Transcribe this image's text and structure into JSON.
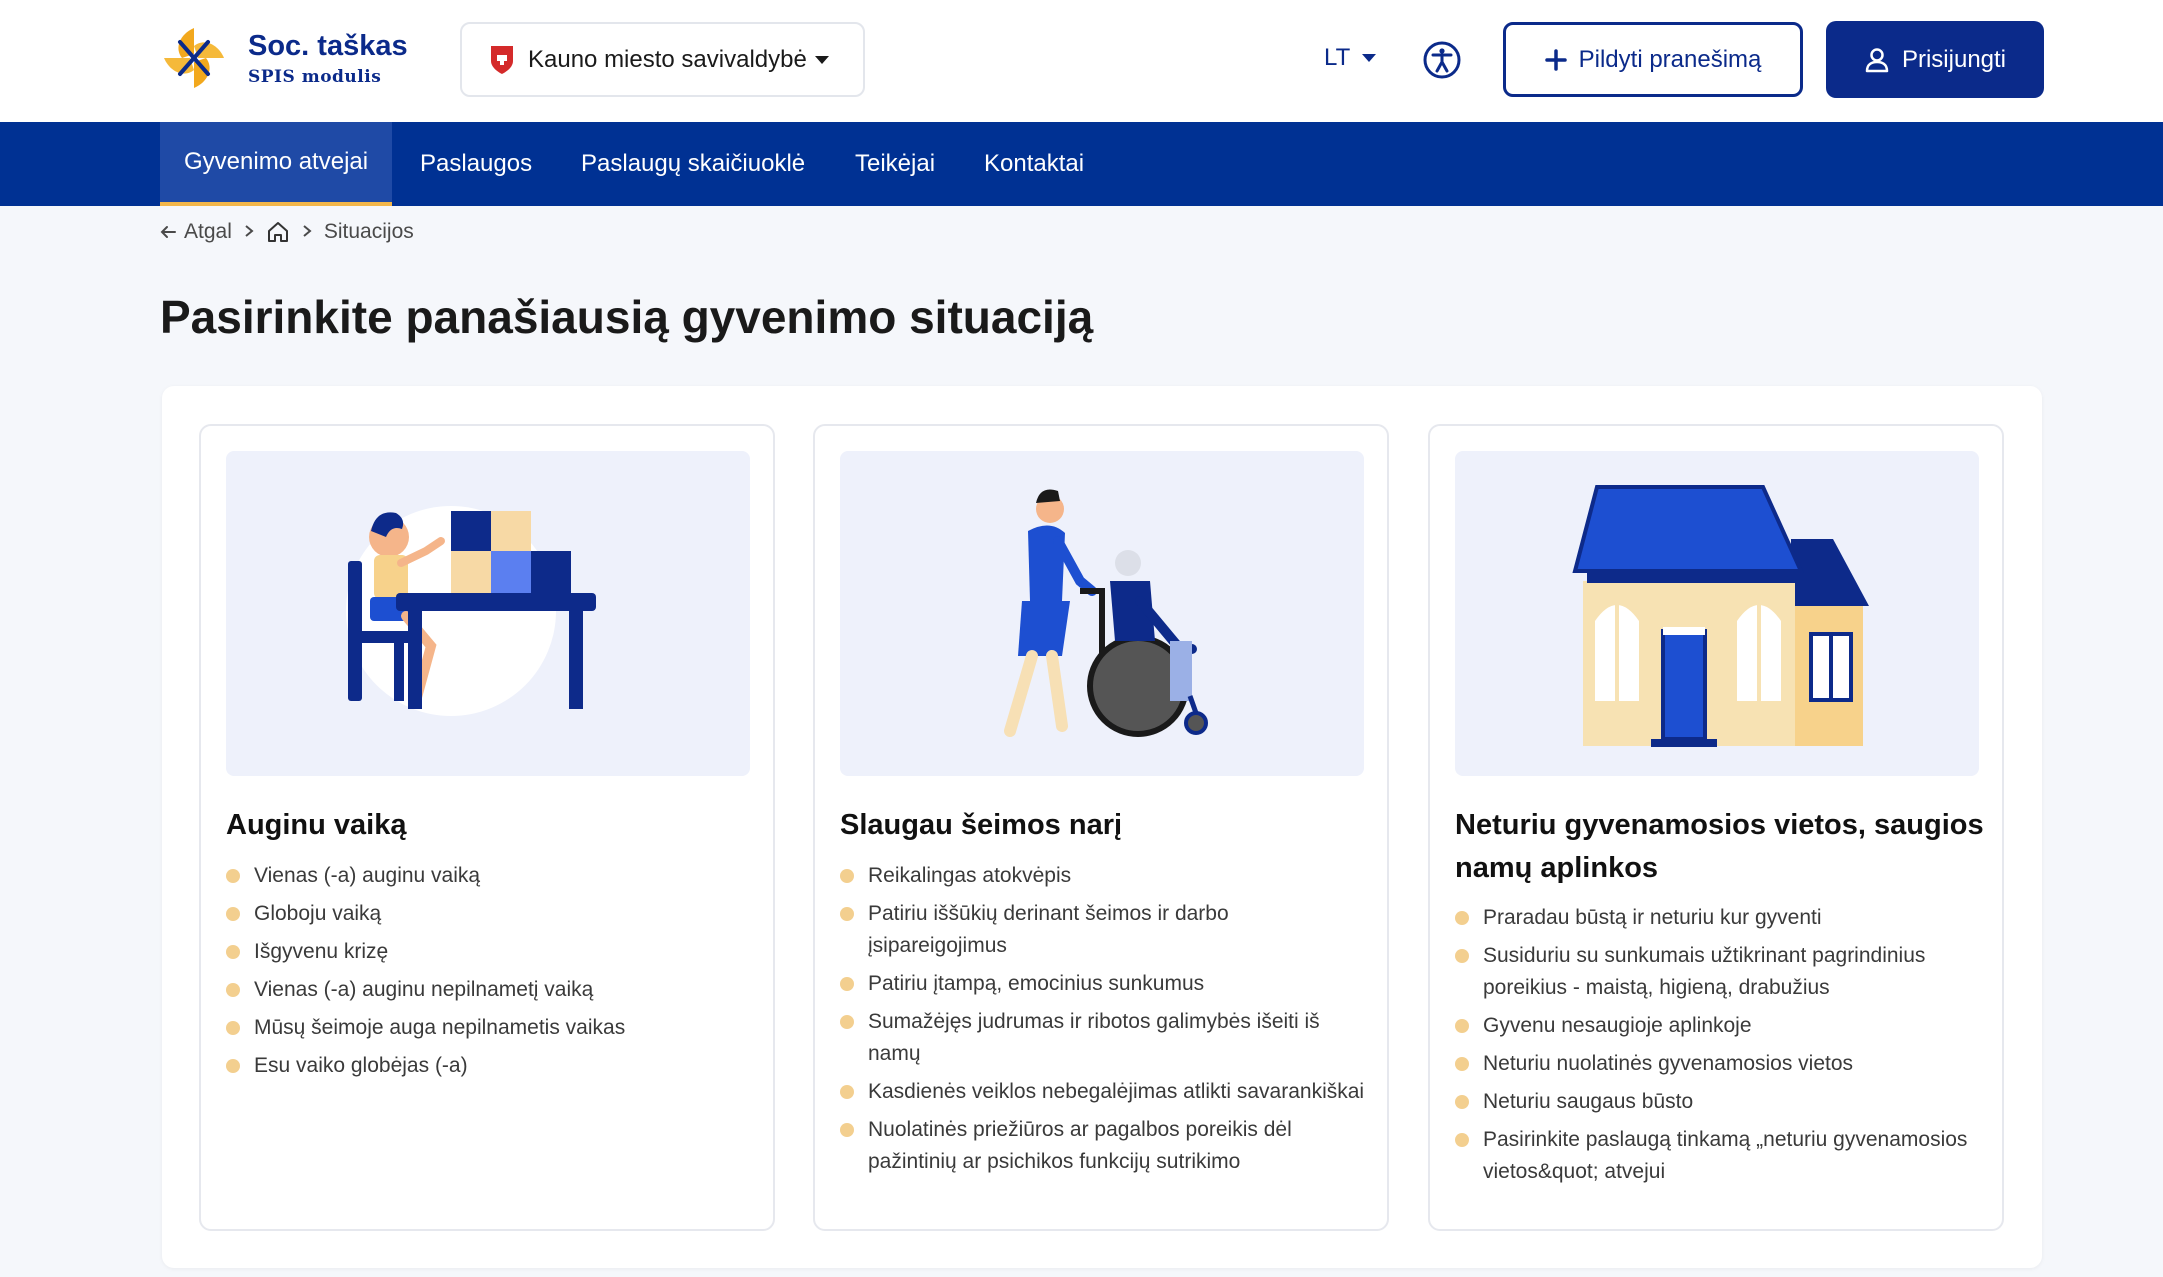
{
  "brand": {
    "title": "Soc. taškas",
    "subtitle": "SPIS modulis"
  },
  "header": {
    "municipality": "Kauno miesto savivaldybė",
    "language": "LT",
    "report_button": "Pildyti pranešimą",
    "login_button": "Prisijungti"
  },
  "nav": {
    "items": [
      {
        "label": "Gyvenimo atvejai",
        "active": true
      },
      {
        "label": "Paslaugos"
      },
      {
        "label": "Paslaugų skaičiuoklė"
      },
      {
        "label": "Teikėjai"
      },
      {
        "label": "Kontaktai"
      }
    ]
  },
  "breadcrumb": {
    "back": "Atgal",
    "current": "Situacijos"
  },
  "page": {
    "title": "Pasirinkite panašiausią gyvenimo situaciją"
  },
  "cards": [
    {
      "title": "Auginu vaiką",
      "items": [
        "Vienas (-a) auginu vaiką",
        "Globoju vaiką",
        "Išgyvenu krizę",
        "Vienas (-a) auginu nepilnametį vaiką",
        "Mūsų šeimoje auga nepilnametis vaikas",
        "Esu vaiko globėjas (-a)"
      ]
    },
    {
      "title": "Slaugau šeimos narį",
      "items": [
        "Reikalingas atokvėpis",
        "Patiriu iššūkių derinant šeimos ir darbo įsipareigojimus",
        "Patiriu įtampą, emocinius sunkumus",
        "Sumažėjęs judrumas ir ribotos galimybės išeiti iš namų",
        "Kasdienės veiklos nebegalėjimas atlikti savarankiškai",
        "Nuolatinės priežiūros ar pagalbos poreikis dėl pažintinių ar psichikos funkcijų sutrikimo"
      ]
    },
    {
      "title": "Neturiu gyvenamosios vietos, saugios namų aplinkos",
      "items": [
        "Praradau būstą ir neturiu kur gyventi",
        "Susiduriu su sunkumais užtikrinant pagrindinius poreikius - maistą, higieną, drabužius",
        "Gyvenu nesaugioje aplinkoje",
        "Neturiu nuolatinės gyvenamosios vietos",
        "Neturiu saugaus būsto",
        "Pasirinkite paslaugą tinkamą „neturiu gyvenamosios vietos&quot; atvejui"
      ]
    }
  ],
  "colors": {
    "primary": "#0b2a8a",
    "nav": "#003193",
    "accent": "#f2b64a",
    "bullet": "#f3cf8f"
  }
}
